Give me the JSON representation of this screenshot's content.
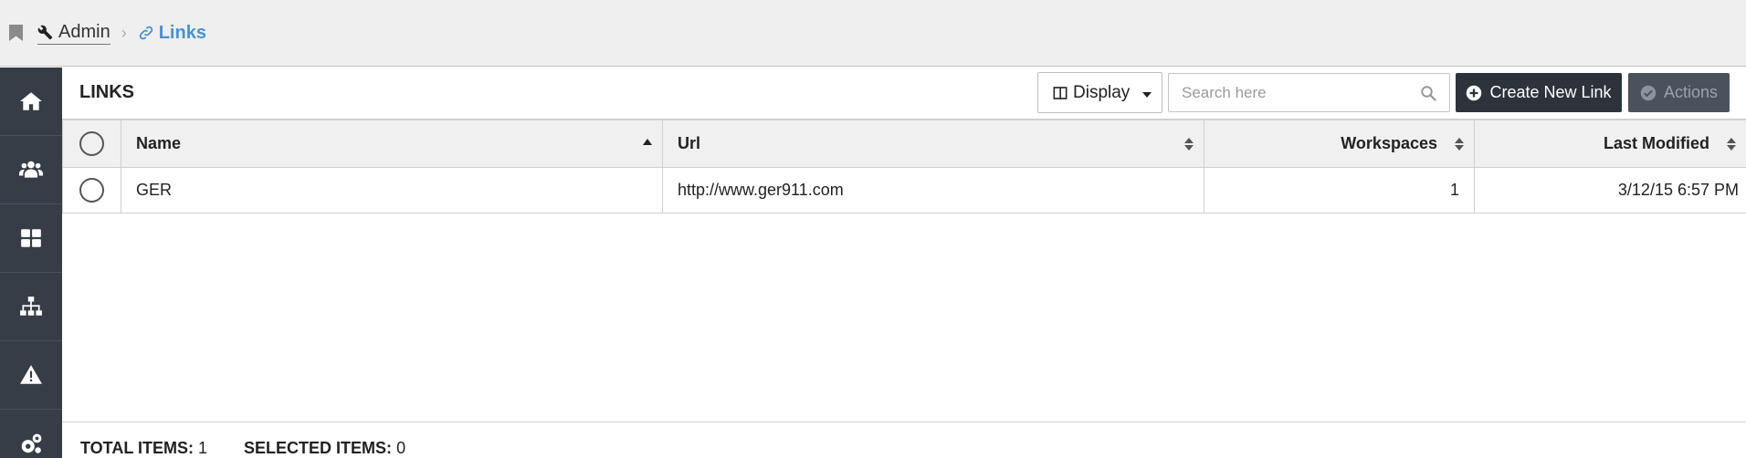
{
  "breadcrumb": {
    "admin_label": "Admin",
    "current_label": "Links"
  },
  "page": {
    "title": "LINKS"
  },
  "toolbar": {
    "display_label": "Display",
    "search_placeholder": "Search here",
    "create_label": "Create New Link",
    "actions_label": "Actions"
  },
  "sidebar": {
    "items": [
      {
        "icon": "home-icon"
      },
      {
        "icon": "users-icon"
      },
      {
        "icon": "dashboard-icon"
      },
      {
        "icon": "sitemap-icon"
      },
      {
        "icon": "warning-icon"
      },
      {
        "icon": "gears-icon"
      }
    ]
  },
  "table": {
    "columns": [
      "Name",
      "Url",
      "Workspaces",
      "Last Modified"
    ],
    "rows": [
      {
        "name": "GER",
        "url": "http://www.ger911.com",
        "workspaces": "1",
        "last_modified": "3/12/15 6:57 PM"
      }
    ]
  },
  "footer": {
    "total_label": "TOTAL ITEMS:",
    "total_value": "1",
    "selected_label": "SELECTED ITEMS:",
    "selected_value": "0"
  },
  "colors": {
    "sidebar_bg": "#363d47",
    "link_blue": "#4a90d9",
    "primary_button": "#2d333b",
    "disabled_button": "#4a525d"
  }
}
